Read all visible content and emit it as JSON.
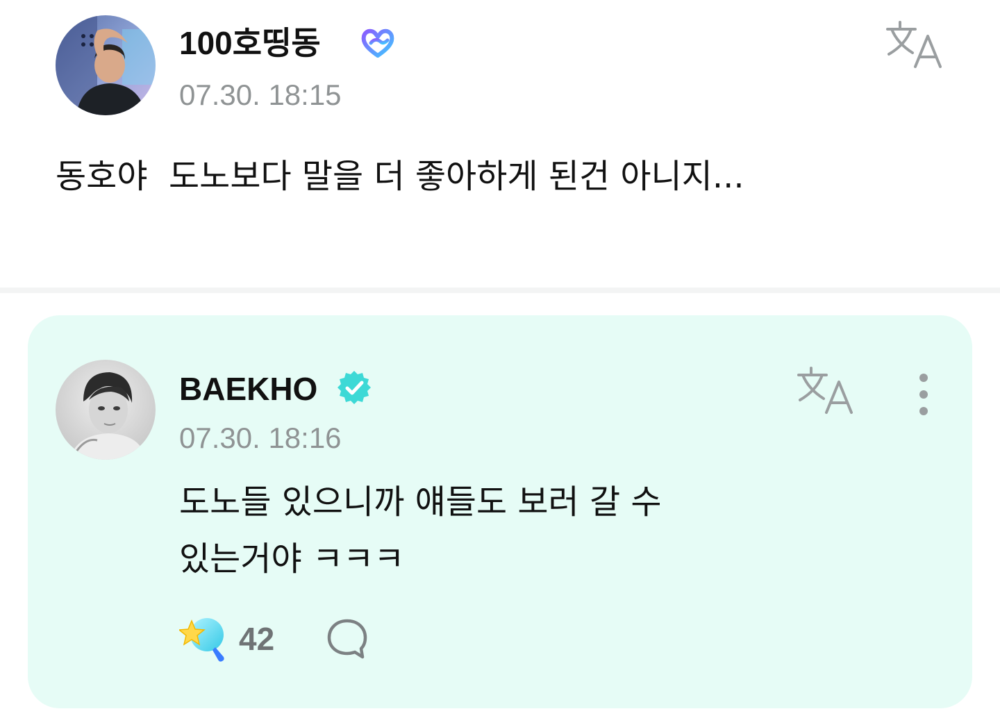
{
  "post": {
    "author": "100호띵동",
    "timestamp": "07.30. 18:15",
    "body": "동호야  도노보다 말을 더 좋아하게 된건 아니지...",
    "icons": {
      "avatar": "user-avatar",
      "badge": "fan-heart-badge-icon",
      "translate": "translate-icon"
    }
  },
  "reply": {
    "author": "BAEKHO",
    "timestamp": "07.30. 18:16",
    "body_lines": [
      "도노들 있으니까 얘들도 보러 갈 수",
      "있는거야 ㅋㅋㅋ"
    ],
    "like_count": "42",
    "icons": {
      "avatar": "artist-avatar",
      "badge": "verified-badge-icon",
      "translate": "translate-icon",
      "more": "more-vertical-icon",
      "like": "star-like-icon",
      "comment": "comment-bubble-icon"
    }
  },
  "colors": {
    "card_background": "#e6fcf6",
    "verified": "#3dd9d6",
    "fan_badge_gradient": [
      "#7b5cff",
      "#3fd0ff"
    ],
    "muted_text": "#8f9394",
    "icon_gray": "#9a9ea0"
  }
}
